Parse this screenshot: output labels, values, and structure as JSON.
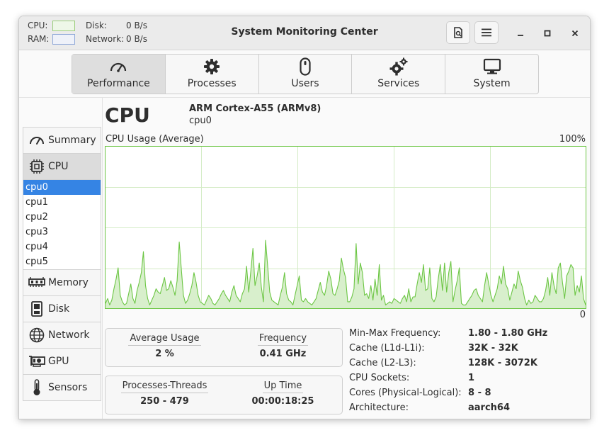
{
  "header": {
    "cpu_label": "CPU:",
    "ram_label": "RAM:",
    "disk_label": "Disk:",
    "disk_value": "0 B/s",
    "network_label": "Network:",
    "network_value": "0 B/s",
    "cpu_color": "#9acd7a",
    "ram_color": "#8fa8d8",
    "title": "System Monitoring Center"
  },
  "tabs": [
    {
      "label": "Performance",
      "icon": "speedometer-icon"
    },
    {
      "label": "Processes",
      "icon": "gear-icon"
    },
    {
      "label": "Users",
      "icon": "mouse-icon"
    },
    {
      "label": "Services",
      "icon": "gears-icon"
    },
    {
      "label": "System",
      "icon": "monitor-icon"
    }
  ],
  "sidebar": {
    "summary": "Summary",
    "cpu": "CPU",
    "cpus": [
      "cpu0",
      "cpu1",
      "cpu2",
      "cpu3",
      "cpu4",
      "cpu5"
    ],
    "memory": "Memory",
    "disk": "Disk",
    "network": "Network",
    "gpu": "GPU",
    "sensors": "Sensors"
  },
  "main": {
    "title": "CPU",
    "model": "ARM Cortex-A55 (ARMv8)",
    "device": "cpu0",
    "graph_label": "CPU Usage (Average)",
    "graph_max": "100%",
    "graph_min": "0"
  },
  "chart_data": {
    "type": "area",
    "ylim": [
      0,
      100
    ],
    "grid": true,
    "line_color": "#6cc644",
    "fill_color": "#d8efcc",
    "values": [
      3,
      6,
      2,
      5,
      12,
      18,
      25,
      8,
      4,
      2,
      3,
      9,
      15,
      6,
      3,
      11,
      16,
      22,
      35,
      14,
      6,
      2,
      5,
      8,
      12,
      10,
      9,
      14,
      19,
      11,
      12,
      17,
      13,
      8,
      17,
      41,
      24,
      8,
      3,
      5,
      9,
      14,
      22,
      16,
      8,
      4,
      3,
      2,
      5,
      8,
      6,
      3,
      2,
      4,
      6,
      9,
      11,
      8,
      6,
      4,
      10,
      14,
      8,
      6,
      4,
      9,
      12,
      26,
      10,
      23,
      37,
      14,
      20,
      28,
      13,
      4,
      42,
      26,
      10,
      5,
      4,
      3,
      2,
      8,
      13,
      22,
      9,
      5,
      4,
      2,
      8,
      14,
      20,
      5,
      4,
      6,
      4,
      3,
      2,
      4,
      6,
      11,
      16,
      10,
      8,
      14,
      23,
      18,
      9,
      8,
      12,
      17,
      31,
      24,
      19,
      4,
      4,
      7,
      12,
      40,
      15,
      28,
      22,
      8,
      9,
      6,
      14,
      5,
      18,
      8,
      27,
      5,
      8,
      2,
      3,
      4,
      3,
      6,
      5,
      4,
      3,
      6,
      8,
      4,
      12,
      4,
      7,
      7,
      15,
      22,
      16,
      27,
      11,
      12,
      25,
      6,
      4,
      7,
      18,
      27,
      11,
      28,
      10,
      22,
      29,
      4,
      11,
      17,
      25,
      3,
      2,
      2,
      4,
      6,
      8,
      11,
      12,
      8,
      6,
      4,
      14,
      22,
      15,
      8,
      4,
      8,
      12,
      20,
      15,
      26,
      15,
      12,
      5,
      10,
      15,
      12,
      23,
      17,
      13,
      6,
      2,
      5,
      3,
      4,
      8,
      6,
      4,
      4,
      6,
      11,
      19,
      8,
      22,
      14,
      9,
      25,
      28,
      16,
      6,
      20,
      23,
      27,
      25,
      8,
      14,
      10,
      20,
      6,
      2
    ]
  },
  "cards": {
    "average_usage_label": "Average Usage",
    "average_usage_value": "2 %",
    "frequency_label": "Frequency",
    "frequency_value": "0.41 GHz",
    "processes_label": "Processes-Threads",
    "processes_value": "250 - 479",
    "uptime_label": "Up Time",
    "uptime_value": "00:00:18:25"
  },
  "specs": [
    {
      "key": "Min-Max Frequency:",
      "value": "1.80 - 1.80 GHz"
    },
    {
      "key": "Cache (L1d-L1i):",
      "value": "32K - 32K"
    },
    {
      "key": "Cache (L2-L3):",
      "value": "128K - 3072K"
    },
    {
      "key": "CPU Sockets:",
      "value": "1"
    },
    {
      "key": "Cores (Physical-Logical):",
      "value": "8 - 8"
    },
    {
      "key": "Architecture:",
      "value": "aarch64"
    }
  ]
}
